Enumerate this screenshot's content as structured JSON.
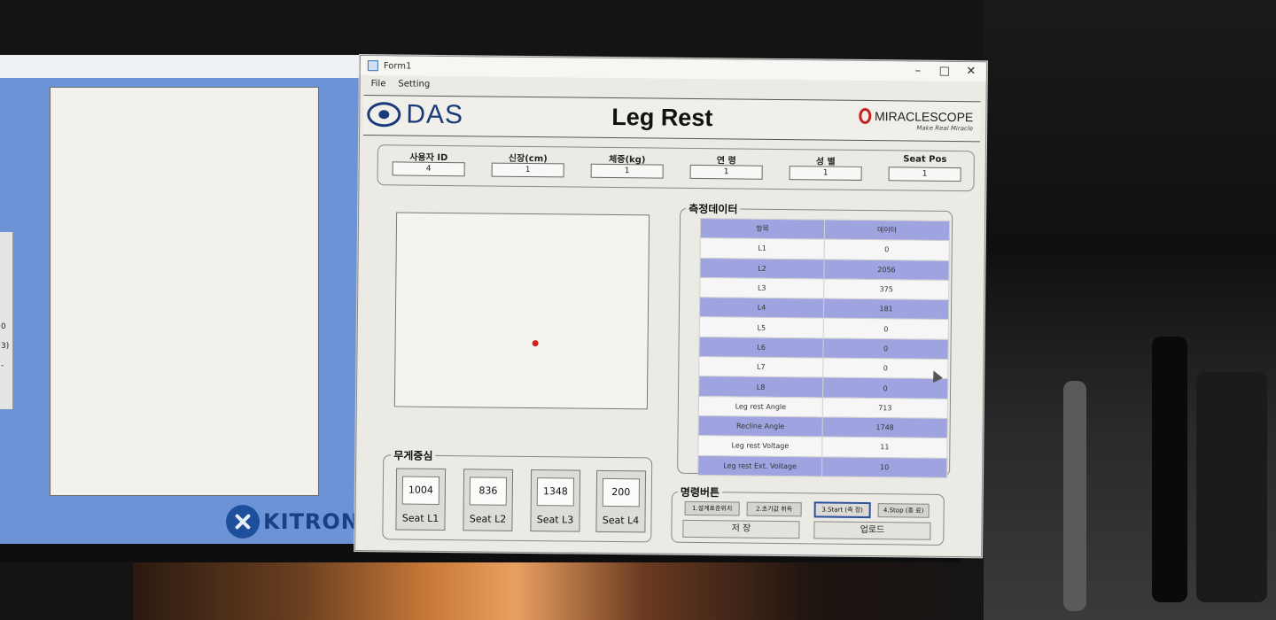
{
  "window": {
    "title": "Form1",
    "minimize": "–",
    "maximize": "□",
    "close": "✕"
  },
  "menu": {
    "file": "File",
    "setting": "Setting"
  },
  "header": {
    "logo_text": "DAS",
    "title": "Leg Rest",
    "brand": "MIRACLESCOPE",
    "brand_tagline": "Make Real Miracle"
  },
  "user_info": {
    "fields": [
      {
        "label": "사용자 ID",
        "value": "4"
      },
      {
        "label": "신장(cm)",
        "value": "1"
      },
      {
        "label": "체중(kg)",
        "value": "1"
      },
      {
        "label": "연 령",
        "value": "1"
      },
      {
        "label": "성 별",
        "value": "1"
      },
      {
        "label": "Seat Pos",
        "value": "1"
      }
    ]
  },
  "measurement": {
    "title": "측정데이터",
    "headers": [
      "항목",
      "데이터"
    ],
    "rows": [
      {
        "item": "L1",
        "value": "0"
      },
      {
        "item": "L2",
        "value": "2056"
      },
      {
        "item": "L3",
        "value": "375"
      },
      {
        "item": "L4",
        "value": "181"
      },
      {
        "item": "L5",
        "value": "0"
      },
      {
        "item": "L6",
        "value": "0"
      },
      {
        "item": "L7",
        "value": "0"
      },
      {
        "item": "L8",
        "value": "0"
      },
      {
        "item": "Leg rest Angle",
        "value": "713"
      },
      {
        "item": "Recline Angle",
        "value": "1748"
      },
      {
        "item": "Leg rest Voltage",
        "value": "11"
      },
      {
        "item": "Leg rest Ext. Voltage",
        "value": "10"
      }
    ]
  },
  "weight_center": {
    "title": "무게중심",
    "seats": [
      {
        "value": "1004",
        "name": "Seat L1"
      },
      {
        "value": "836",
        "name": "Seat L2"
      },
      {
        "value": "1348",
        "name": "Seat L3"
      },
      {
        "value": "200",
        "name": "Seat L4"
      }
    ]
  },
  "commands": {
    "title": "명령버튼",
    "step1": "1.설계표준위치",
    "step2": "2.초기값 취득",
    "step3": "3.Start (측 정)",
    "step4": "4.Stop (종 료)",
    "save": "저 장",
    "upload": "업로드"
  },
  "background_window": {
    "brand": "KITRONYX",
    "strip_values": [
      "0",
      "3)",
      "-"
    ]
  },
  "colors": {
    "table_highlight": "#9fa3e0",
    "cog_dot": "#d21e1e",
    "das_blue": "#1a3b7a",
    "kitronyx_blue": "#1e4f9c"
  }
}
